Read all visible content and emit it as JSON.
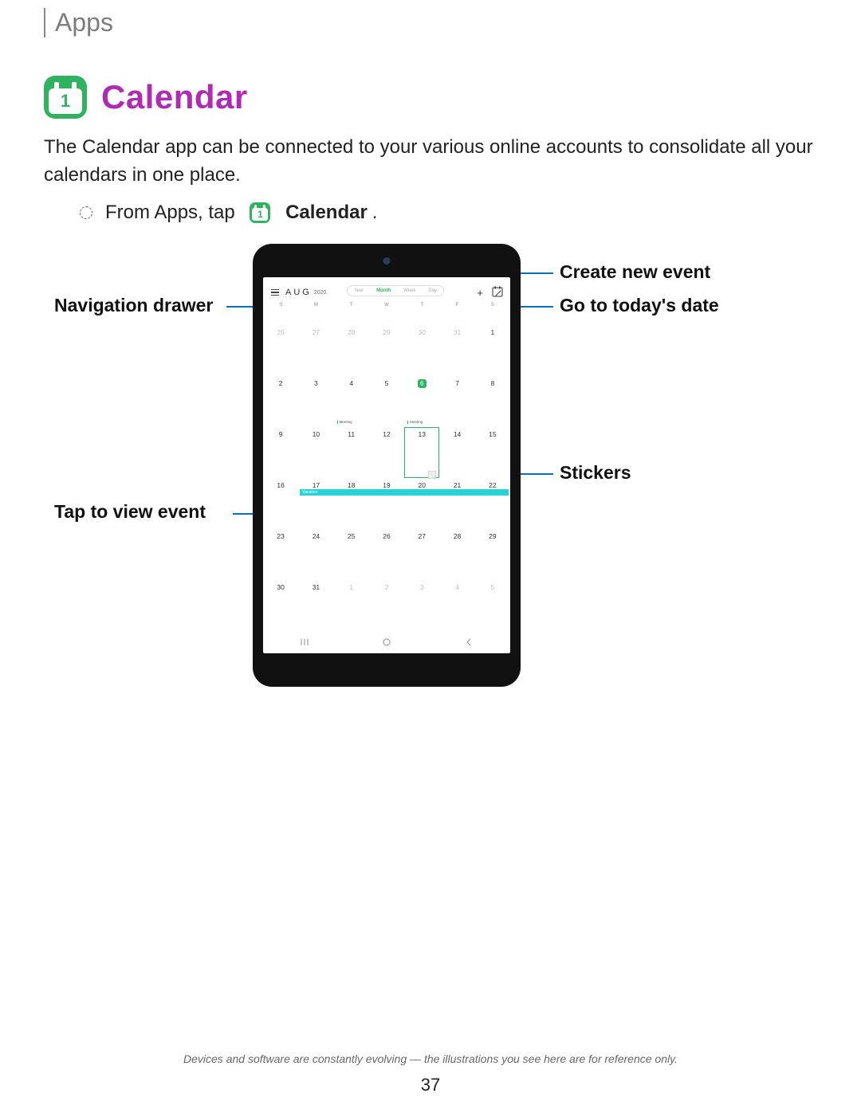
{
  "header": {
    "section": "Apps"
  },
  "title": {
    "app_name": "Calendar",
    "icon_day": "1"
  },
  "intro": "The Calendar app can be connected to your various online accounts to consolidate all your calendars in one place.",
  "instruction": {
    "prefix": "From Apps, tap",
    "bold": "Calendar",
    "suffix": ".",
    "icon_day": "1"
  },
  "callouts": {
    "nav_drawer": "Navigation drawer",
    "tap_view": "Tap to view event",
    "create_event": "Create new event",
    "today": "Go to today's date",
    "stickers": "Stickers"
  },
  "tablet": {
    "month": "AUG",
    "year": "2020",
    "views": {
      "year": "Year",
      "month": "Month",
      "week": "Week",
      "day": "Day"
    },
    "dow": [
      "S",
      "M",
      "T",
      "W",
      "T",
      "F",
      "S"
    ],
    "weeks": [
      {
        "days": [
          "26",
          "27",
          "28",
          "29",
          "30",
          "31",
          "1"
        ],
        "dim": [
          0,
          1,
          2,
          3,
          4,
          5
        ]
      },
      {
        "days": [
          "2",
          "3",
          "4",
          "5",
          "6",
          "7",
          "8"
        ],
        "today_idx": 4,
        "events": [
          {
            "col": 2,
            "label": "Meeting"
          },
          {
            "col": 4,
            "label": "Meeting"
          }
        ]
      },
      {
        "days": [
          "9",
          "10",
          "11",
          "12",
          "13",
          "14",
          "15"
        ]
      },
      {
        "days": [
          "16",
          "17",
          "18",
          "19",
          "20",
          "21",
          "22"
        ],
        "vacation_label": "Vacation"
      },
      {
        "days": [
          "23",
          "24",
          "25",
          "26",
          "27",
          "28",
          "29"
        ]
      },
      {
        "days": [
          "30",
          "31",
          "1",
          "2",
          "3",
          "4",
          "5"
        ],
        "dim": [
          2,
          3,
          4,
          5,
          6
        ]
      }
    ]
  },
  "footer": {
    "note": "Devices and software are constantly evolving — the illustrations you see here are for reference only.",
    "page": "37"
  }
}
